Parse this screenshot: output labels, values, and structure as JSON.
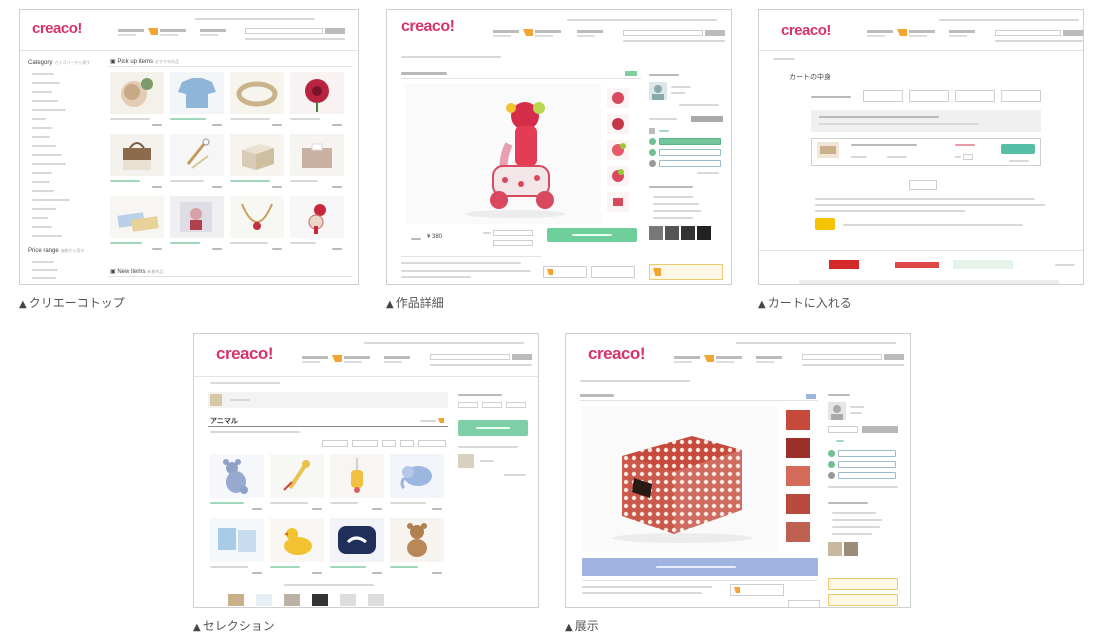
{
  "brand": {
    "logo": "creaco!",
    "accent": "#d6336c",
    "orange": "#f0a534",
    "green": "#6fcf9b"
  },
  "shots": [
    {
      "id": "top",
      "caption": "クリエーコトップ",
      "sections": {
        "pickup": "Pick up items",
        "new": "New items",
        "category": "Category",
        "price": "Price range"
      }
    },
    {
      "id": "detail",
      "caption": "作品詳細",
      "price": "¥ 380"
    },
    {
      "id": "cart",
      "caption": "カートに入れる",
      "title": "カートの中身"
    },
    {
      "id": "selection",
      "caption": "セレクション",
      "title": "アニマル"
    },
    {
      "id": "exhibit",
      "caption": "展示"
    }
  ]
}
